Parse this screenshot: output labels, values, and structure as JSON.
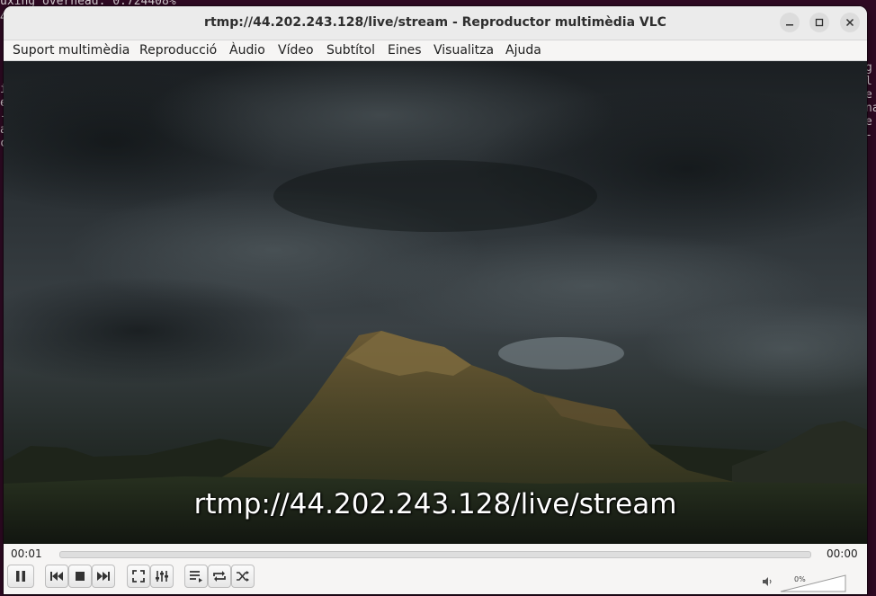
{
  "terminal": {
    "top_line": "uxing overhead: 0.724408%",
    "right_chars": [
      "g",
      "l",
      "e",
      "na",
      "e",
      "-"
    ],
    "left_chars": [
      "4",
      "i",
      "e",
      "-",
      "a",
      "c",
      "t"
    ]
  },
  "window": {
    "title": "rtmp://44.202.243.128/live/stream - Reproductor multimèdia VLC"
  },
  "menu": [
    {
      "label": "Suport multimèdia"
    },
    {
      "label": "Reproducció"
    },
    {
      "label": "Àudio"
    },
    {
      "label": "Vídeo"
    },
    {
      "label": "Subtítol"
    },
    {
      "label": "Eines"
    },
    {
      "label": "Visualitza"
    },
    {
      "label": "Ajuda"
    }
  ],
  "video": {
    "caption": "rtmp://44.202.243.128/live/stream"
  },
  "playback": {
    "elapsed": "00:01",
    "remaining": "00:00",
    "progress_fraction": 0.0
  },
  "volume": {
    "percent_label": "0%",
    "level_fraction": 0.0
  },
  "icons": {
    "play_pause": "pause-icon",
    "prev": "previous-icon",
    "stop": "stop-icon",
    "next": "next-icon",
    "fullscreen": "fullscreen-icon",
    "extended": "equalizer-icon",
    "playlist": "playlist-icon",
    "loop": "loop-icon",
    "shuffle": "shuffle-icon",
    "volume": "speaker-icon"
  }
}
